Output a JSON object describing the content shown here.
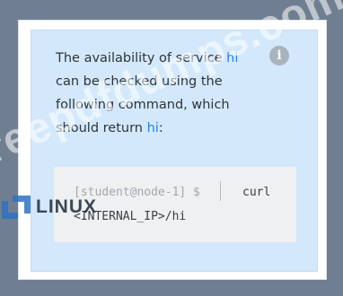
{
  "info": {
    "line1_pre": "The availability of service ",
    "line1_accent": "hi",
    "line2": "can be checked using the",
    "line3": "following command, which",
    "line4_pre": "should return ",
    "line4_accent": "hi",
    "line4_post": ":",
    "icon": "info-icon"
  },
  "code": {
    "prompt": "[student@node-1] $",
    "command_line1": "curl",
    "command_line2": "<INTERNAL_IP>/hi"
  },
  "overlay": {
    "logo_text": "LINUX",
    "watermark": "freepdfdumps.com"
  },
  "colors": {
    "background": "#6f7f91",
    "panel": "#d3e9fb",
    "accent": "#2b7fd6",
    "code_bg": "#eef0f2"
  }
}
